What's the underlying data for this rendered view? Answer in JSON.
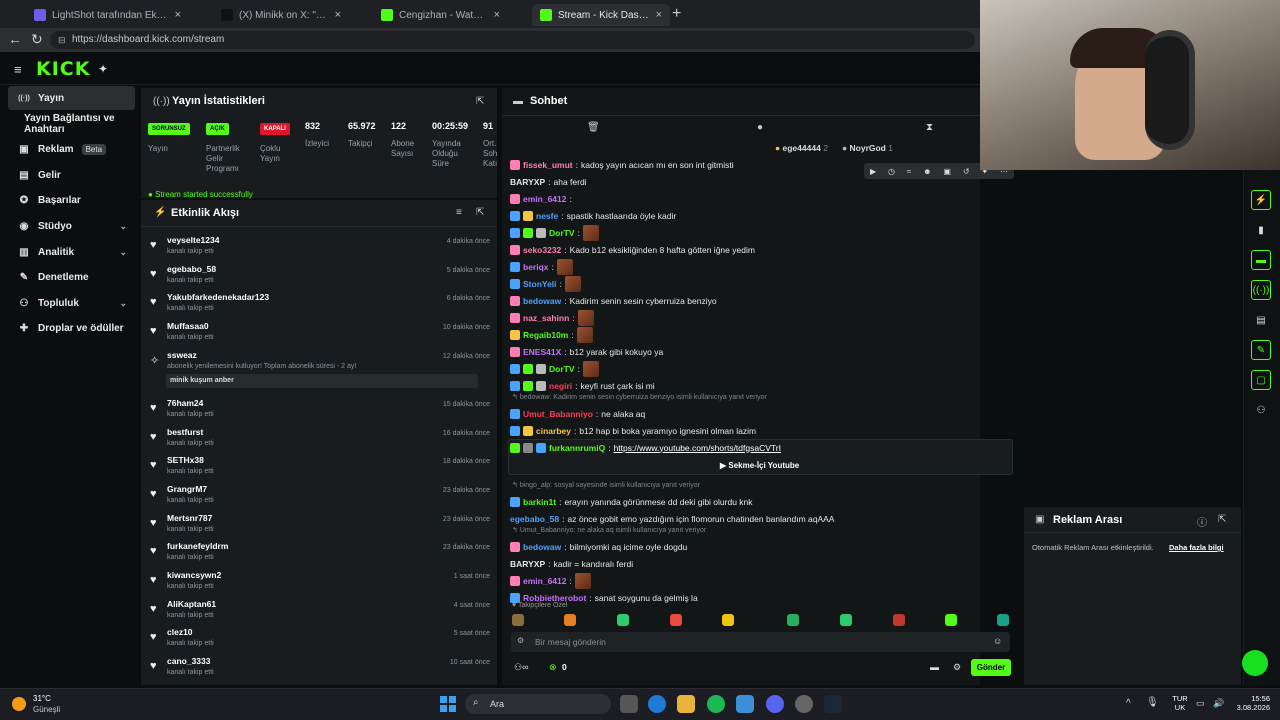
{
  "browser": {
    "tabs": [
      {
        "title": "LightShot tarafından Ekran Görüntü",
        "active": false
      },
      {
        "title": "(X) Minikk on X: \"NBDS İFSA ;) htt",
        "active": false
      },
      {
        "title": "Cengizhan - Watch clips on Kick",
        "active": false
      },
      {
        "title": "Stream - Kick Dashboard",
        "active": true
      }
    ],
    "url": "https://dashboard.kick.com/stream"
  },
  "header": {
    "logo": "KICK"
  },
  "sidebar": {
    "items": [
      {
        "label": "Yayın",
        "icon": "broadcast-icon",
        "active": true
      },
      {
        "label": "Yayın Bağlantısı ve Anahtarı",
        "icon": "",
        "active": false
      },
      {
        "label": "Reklam",
        "icon": "ad-icon",
        "badge": "Beta"
      },
      {
        "label": "Gelir",
        "icon": "money-icon"
      },
      {
        "label": "Başarılar",
        "icon": "trophy-icon"
      },
      {
        "label": "Stüdyo",
        "icon": "studio-icon",
        "chevron": true
      },
      {
        "label": "Analitik",
        "icon": "chart-icon",
        "chevron": true
      },
      {
        "label": "Denetleme",
        "icon": "wrench-icon"
      },
      {
        "label": "Topluluk",
        "icon": "community-icon",
        "chevron": true
      },
      {
        "label": "Droplar ve ödüller",
        "icon": "gift-icon"
      }
    ]
  },
  "stats": {
    "title": "Yayın İstatistikleri",
    "columns": [
      {
        "value": "SORUNSUZ",
        "label": "Yayın",
        "style": "green"
      },
      {
        "value": "AÇIK",
        "label": "Partnerlik Gelir Programı",
        "style": "green"
      },
      {
        "value": "KAPALI",
        "label": "Çoklu Yayın",
        "style": "red"
      },
      {
        "value": "832",
        "label": "İzleyici"
      },
      {
        "value": "65.972",
        "label": "Takipçi"
      },
      {
        "value": "122",
        "label": "Abone Sayısı"
      },
      {
        "value": "00:25:59",
        "label": "Yayında Olduğu Süre"
      },
      {
        "value": "91",
        "label": "Ort. Soh Katı"
      }
    ],
    "toast": "Stream started successfully"
  },
  "activity": {
    "title": "Etkinlik Akışı",
    "items": [
      {
        "name": "veyselte1234",
        "sub": "kanalı takip etti",
        "time": "4 dakika önce"
      },
      {
        "name": "egebabo_58",
        "sub": "kanalı takip etti",
        "time": "5 dakika önce"
      },
      {
        "name": "Yakubfarkedenekadar123",
        "sub": "kanalı takip etti",
        "time": "6 dakika önce"
      },
      {
        "name": "Muffasaa0",
        "sub": "kanalı takip etti",
        "time": "10 dakika önce"
      },
      {
        "name": "ssweaz",
        "sub": "abonelik yenilemesini kutluyor! Toplam abonelik süresi - 2 ay!",
        "time": "12 dakika önce",
        "note": "minik kuşum anber",
        "sub_event": true
      },
      {
        "name": "76ham24",
        "sub": "kanalı takip etti",
        "time": "15 dakika önce"
      },
      {
        "name": "bestfurst",
        "sub": "kanalı takip etti",
        "time": "16 dakika önce"
      },
      {
        "name": "SETHx38",
        "sub": "kanalı takip etti",
        "time": "18 dakika önce"
      },
      {
        "name": "GrangrM7",
        "sub": "kanalı takip etti",
        "time": "23 dakika önce"
      },
      {
        "name": "Mertsnr787",
        "sub": "kanalı takip etti",
        "time": "23 dakika önce"
      },
      {
        "name": "furkanefeyldrm",
        "sub": "kanalı takip etti",
        "time": "23 dakika önce"
      },
      {
        "name": "kiwancsywn2",
        "sub": "kanalı takip etti",
        "time": "1 saat önce"
      },
      {
        "name": "AliKaptan61",
        "sub": "kanalı takip etti",
        "time": "4 saat önce"
      },
      {
        "name": "clez10",
        "sub": "kanalı takip etti",
        "time": "5 saat önce"
      },
      {
        "name": "cano_3333",
        "sub": "kanalı takip etti",
        "time": "10 saat önce"
      }
    ]
  },
  "chat": {
    "title": "Sohbet",
    "pinned_users": [
      {
        "name": "ege44444",
        "count": "2"
      },
      {
        "name": "NoyrGod",
        "count": "1"
      }
    ],
    "messages": [
      {
        "user": "fissek_umut",
        "color": "#ff7eb6",
        "text": "kadoş yayın acıcan mı en son int gitmisti",
        "badges": [
          "#ff7eb6"
        ]
      },
      {
        "user": "BARYXP",
        "color": "#e6e6e6",
        "text": "aha ferdi",
        "badges": []
      },
      {
        "user": "emin_6412",
        "color": "#c770ff",
        "text": "",
        "badges": [
          "#ff7eb6"
        ]
      },
      {
        "user": "nesfe",
        "color": "#4aa3ff",
        "text": "spastik hastlaarıda öyle kadir",
        "badges": [
          "#4aa3ff",
          "#f5c542"
        ]
      },
      {
        "user": "DorTV",
        "color": "#53fc18",
        "text": "",
        "badges": [
          "#4aa3ff",
          "#53fc18",
          "#bbb"
        ],
        "emote": true
      },
      {
        "user": "seko3232",
        "color": "#ff7eb6",
        "text": "Kado b12 eksikliğinden 8 hafta götten iğne yedim",
        "badges": [
          "#ff7eb6"
        ]
      },
      {
        "user": "beriqx",
        "color": "#c770ff",
        "text": "",
        "badges": [
          "#4aa3ff"
        ],
        "emote": true
      },
      {
        "user": "StonYeli",
        "color": "#4aa3ff",
        "text": "",
        "badges": [
          "#4aa3ff"
        ],
        "emote": true
      },
      {
        "user": "bedowaw",
        "color": "#4aa3ff",
        "text": "Kadirim senin sesin cyberruiza benziyo",
        "badges": [
          "#ff7eb6"
        ]
      },
      {
        "user": "naz_sahinn",
        "color": "#ff7eb6",
        "text": "",
        "badges": [
          "#ff7eb6"
        ],
        "emote": true
      },
      {
        "user": "Regaib10m",
        "color": "#53fc18",
        "text": "",
        "badges": [
          "#f5c542"
        ],
        "emote": true
      },
      {
        "user": "ENES41X",
        "color": "#c770ff",
        "text": "b12 yarak gibi kokuyo ya",
        "badges": [
          "#ff7eb6"
        ]
      },
      {
        "user": "DorTV",
        "color": "#53fc18",
        "text": "",
        "badges": [
          "#4aa3ff",
          "#53fc18",
          "#bbb"
        ],
        "emote": true
      },
      {
        "user": "negiri",
        "color": "#ff3b5c",
        "text": "keyfi rust çark isi mi",
        "badges": [
          "#4aa3ff",
          "#53fc18",
          "#bbb"
        ]
      },
      {
        "reply": "bedowaw: Kadirim senin sesin cyberruiza benziyo isimli kullanıcıya yanıt veriyor"
      },
      {
        "user": "Umut_Babanniyo",
        "color": "#ff3b5c",
        "text": "ne alaka aq",
        "badges": [
          "#4aa3ff"
        ]
      },
      {
        "user": "cinarbey",
        "color": "#f5c542",
        "text": "b12 hap bi boka yaramıyo ignesini olman lazim",
        "badges": [
          "#4aa3ff",
          "#f5c542"
        ]
      }
    ],
    "link_message": {
      "user": "furkannrumiQ",
      "url": "https://www.youtube.com/shorts/tdfgsaCVTrI",
      "button": "Sekme-İçi Youtube"
    },
    "messages2": [
      {
        "reply": "bingo_alp: sosyal sayesinde isimli kullanıcıya yanıt veriyor"
      },
      {
        "user": "barkin1t",
        "color": "#53fc18",
        "text": "erayın yanında görünmese dd deki gibi olurdu knk",
        "badges": [
          "#4aa3ff"
        ]
      },
      {
        "user": "egebabo_58",
        "color": "#4aa3ff",
        "text": "az önce gobit emo yazdığım için flomorun chatinden banlandım aqAAA",
        "badges": []
      },
      {
        "reply": "Umut_Babanniyo: ne alaka aq isimli kullanıcıya yanıt veriyor"
      },
      {
        "user": "bedowaw",
        "color": "#4aa3ff",
        "text": "bilmiyomki aq icime oyle dogdu",
        "badges": [
          "#ff7eb6"
        ]
      },
      {
        "user": "BARYXP",
        "color": "#e6e6e6",
        "text": "kadir = kandıralı ferdi",
        "badges": []
      },
      {
        "user": "emin_6412",
        "color": "#c770ff",
        "text": "",
        "badges": [
          "#ff7eb6"
        ],
        "emote": true
      },
      {
        "user": "Robbietherobot",
        "color": "#c770ff",
        "text": "sanat soygunu da gelmiş la",
        "badges": [
          "#4aa3ff"
        ]
      }
    ],
    "emote_section": "Takipçilere Özel",
    "input_placeholder": "Bir mesaj gönderin",
    "points": "0",
    "send_label": "Gönder"
  },
  "ad_break": {
    "title": "Reklam Arası",
    "text": "Otomatik Reklam Arası etkinleştirildi.",
    "link": "Daha fazla bilgi"
  },
  "taskbar": {
    "weather_temp": "31°C",
    "weather_text": "Güneşli",
    "search": "Ara",
    "lang1": "TUR",
    "lang2": "UK",
    "time": "15:56",
    "date": "3.08.2026"
  }
}
